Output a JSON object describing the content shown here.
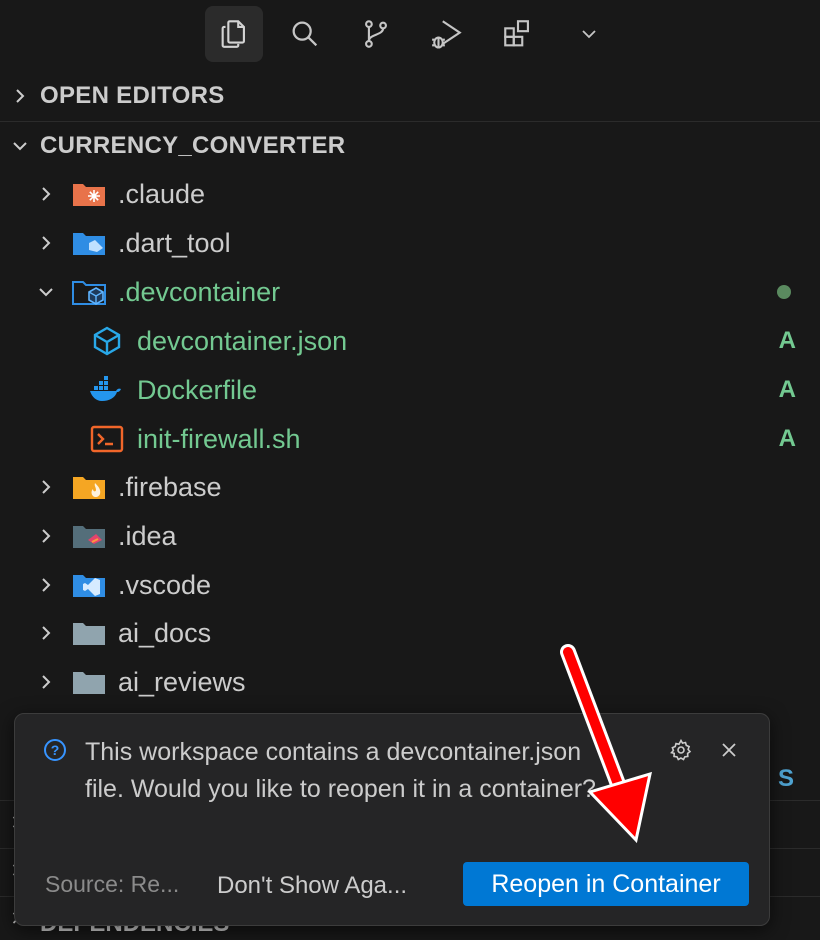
{
  "activity_bar": {
    "items": [
      {
        "icon": "explorer-icon",
        "active": true
      },
      {
        "icon": "search-icon"
      },
      {
        "icon": "source-control-icon"
      },
      {
        "icon": "run-debug-icon"
      },
      {
        "icon": "extensions-icon"
      },
      {
        "icon": "chevron-down-icon"
      }
    ]
  },
  "sections": {
    "open_editors": "OPEN EDITORS",
    "project": "CURRENCY_CONVERTER",
    "dependencies": "DEPENDENCIES"
  },
  "tree": [
    {
      "name": ".claude",
      "icon": "claude-folder-icon",
      "expanded": false
    },
    {
      "name": ".dart_tool",
      "icon": "dart-folder-icon",
      "expanded": false
    },
    {
      "name": ".devcontainer",
      "icon": "devcontainer-folder-icon",
      "expanded": true,
      "status": "modified-dot"
    },
    {
      "name": "devcontainer.json",
      "icon": "devcontainer-file-icon",
      "git": "A"
    },
    {
      "name": "Dockerfile",
      "icon": "docker-icon",
      "git": "A"
    },
    {
      "name": "init-firewall.sh",
      "icon": "shell-icon",
      "git": "A"
    },
    {
      "name": ".firebase",
      "icon": "firebase-folder-icon",
      "expanded": false
    },
    {
      "name": ".idea",
      "icon": "idea-folder-icon",
      "expanded": false
    },
    {
      "name": ".vscode",
      "icon": "vscode-folder-icon",
      "expanded": false
    },
    {
      "name": "ai_docs",
      "icon": "folder-icon",
      "expanded": false
    },
    {
      "name": "ai_reviews",
      "icon": "folder-icon",
      "expanded": false
    }
  ],
  "behind_letter": "S",
  "notification": {
    "message": "This workspace contains a devcontainer.json file. Would you like to reopen it in a container?",
    "source": "Source: Re...",
    "secondary_button": "Don't Show Aga...",
    "primary_button": "Reopen in Container"
  },
  "colors": {
    "added": "#73c991",
    "primary": "#0078d4",
    "arrow": "#ff0000"
  }
}
